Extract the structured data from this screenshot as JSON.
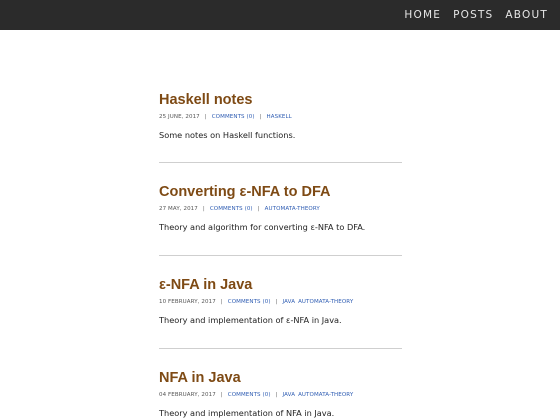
{
  "nav": {
    "items": [
      {
        "label": "HOME"
      },
      {
        "label": "POSTS"
      },
      {
        "label": "ABOUT"
      }
    ]
  },
  "posts": [
    {
      "title": "Haskell notes",
      "date": "25 JUNE, 2017",
      "comments": "COMMENTS (0)",
      "tags": [
        "HASKELL"
      ],
      "summary": "Some notes on Haskell functions."
    },
    {
      "title": "Converting ε-NFA to DFA",
      "date": "27 MAY, 2017",
      "comments": "COMMENTS (0)",
      "tags": [
        "AUTOMATA-THEORY"
      ],
      "summary": "Theory and algorithm for converting ε-NFA to DFA."
    },
    {
      "title": "ε-NFA in Java",
      "date": "10 FEBRUARY, 2017",
      "comments": "COMMENTS (0)",
      "tags": [
        "JAVA",
        "AUTOMATA-THEORY"
      ],
      "summary": "Theory and implementation of ε-NFA in Java."
    },
    {
      "title": "NFA in Java",
      "date": "04 FEBRUARY, 2017",
      "comments": "COMMENTS (0)",
      "tags": [
        "JAVA",
        "AUTOMATA-THEORY"
      ],
      "summary": "Theory and implementation of NFA in Java."
    }
  ]
}
